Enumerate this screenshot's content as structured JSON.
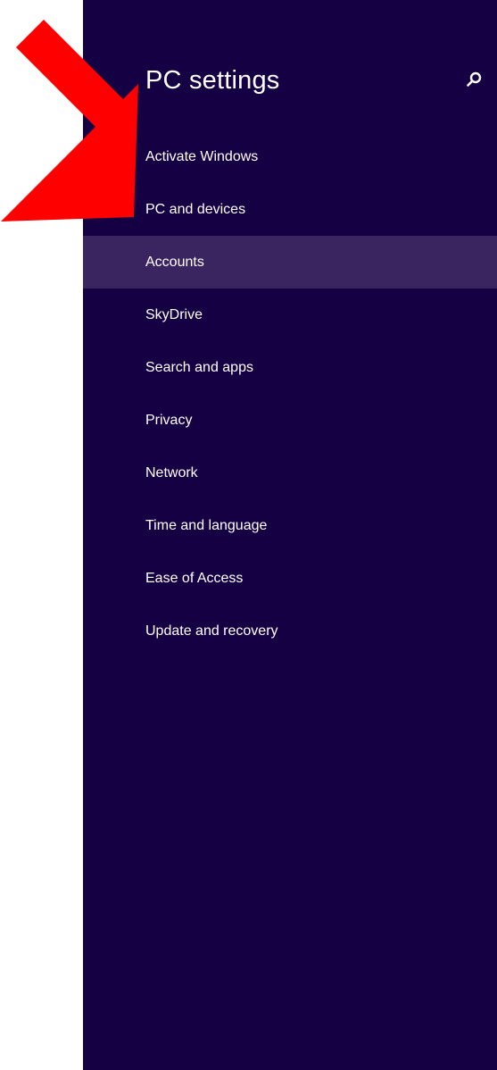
{
  "settings": {
    "title": "PC settings",
    "search_icon": "search-icon",
    "selected_index": 2,
    "nav_items": [
      {
        "label": "Activate Windows"
      },
      {
        "label": "PC and devices"
      },
      {
        "label": "Accounts"
      },
      {
        "label": "SkyDrive"
      },
      {
        "label": "Search and apps"
      },
      {
        "label": "Privacy"
      },
      {
        "label": "Network"
      },
      {
        "label": "Time and language"
      },
      {
        "label": "Ease of Access"
      },
      {
        "label": "Update and recovery"
      }
    ]
  },
  "annotation": {
    "arrow_icon": "red-arrow-annotation",
    "arrow_color": "#ff0000"
  },
  "colors": {
    "panel_background": "#140042",
    "selected_background": "#3a2561",
    "text": "#ffffff"
  }
}
